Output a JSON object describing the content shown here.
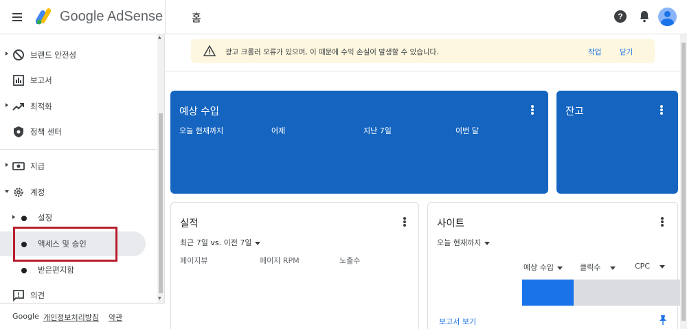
{
  "header": {
    "brand_google": "Google",
    "brand_product": "AdSense",
    "page_title": "홈",
    "help_glyph": "?"
  },
  "sidebar": {
    "items": [
      {
        "label": "브랜드 안전성",
        "icon": "block-icon"
      },
      {
        "label": "보고서",
        "icon": "bar-chart-icon"
      },
      {
        "label": "최적화",
        "icon": "trending-up-icon"
      },
      {
        "label": "정책 센터",
        "icon": "shield-icon"
      },
      {
        "label": "지급",
        "icon": "payments-icon"
      },
      {
        "label": "계정",
        "icon": "gear-icon"
      }
    ],
    "sub_items": [
      {
        "label": "설정"
      },
      {
        "label": "액세스 및 승인",
        "active": true
      },
      {
        "label": "받은편지함"
      }
    ],
    "feedback_label": "의견",
    "footer": {
      "google": "Google",
      "privacy": "개인정보처리방침",
      "terms": "약관"
    }
  },
  "alert": {
    "message": "광고 크롤러 오류가 있으며, 이 때문에 수익 손실이 발생할 수 있습니다.",
    "action_fix": "작업",
    "action_dismiss": "닫기"
  },
  "earnings_card": {
    "title": "예상 수입",
    "columns": [
      "오늘 현재까지",
      "어제",
      "지난 7일",
      "이번 달"
    ]
  },
  "balance_card": {
    "title": "잔고"
  },
  "performance_card": {
    "title": "실적",
    "range_prefix": "최근 7일 ",
    "range_vs": "vs.",
    "range_suffix": " 이전 7일",
    "columns": [
      "페이지뷰",
      "페이지 RPM",
      "노출수"
    ]
  },
  "sites_card": {
    "title": "사이트",
    "range": "오늘 현재까지",
    "metric_selectors": [
      "예상 수입",
      "클릭수",
      "CPC"
    ],
    "report_link": "보고서 보기"
  },
  "colors": {
    "accent_blue": "#1565c0",
    "link_blue": "#1a73e8",
    "highlight_red": "#b71c2c",
    "alert_bg": "#fef7e0"
  }
}
